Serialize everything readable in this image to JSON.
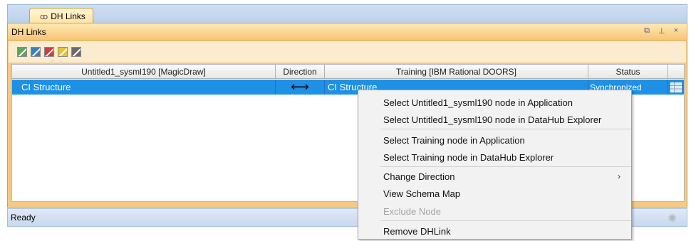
{
  "tab": {
    "label": "DH Links",
    "icon": "dh-links-icon"
  },
  "panel": {
    "title": "DH Links",
    "controls": [
      {
        "name": "restore-icon",
        "glyph": "⧉"
      },
      {
        "name": "pin-icon",
        "glyph": "⊥"
      },
      {
        "name": "close-icon",
        "glyph": "×"
      }
    ]
  },
  "toolbar": {
    "buttons": [
      {
        "name": "green-link-icon",
        "color": "#5ca65c"
      },
      {
        "name": "blue-link-icon",
        "color": "#3a7fc4"
      },
      {
        "name": "red-link-icon",
        "color": "#d43b3b"
      },
      {
        "name": "yellow-link-icon",
        "color": "#e6c43a"
      },
      {
        "name": "gray-link-icon",
        "color": "#6b6b6b"
      }
    ]
  },
  "table": {
    "columns": [
      "Untitled1_sysml190 [MagicDraw]",
      "Direction",
      "Training [IBM Rational DOORS]",
      "Status"
    ],
    "rows": [
      {
        "source": "CI Structure",
        "direction": "⟷",
        "target": "CI Structure",
        "status": "Synchronized"
      }
    ]
  },
  "statusbar": {
    "text": "Ready"
  },
  "context_menu": {
    "items": [
      {
        "label": "Select Untitled1_sysml190 node in Application",
        "enabled": true
      },
      {
        "label": "Select Untitled1_sysml190 node in DataHub Explorer",
        "enabled": true
      },
      {
        "label": "Select Training node in Application",
        "enabled": true
      },
      {
        "label": "Select Training node in DataHub Explorer",
        "enabled": true
      },
      {
        "label": "Change Direction",
        "enabled": true,
        "submenu_arrow": "›"
      },
      {
        "label": "View Schema Map",
        "enabled": true
      },
      {
        "label": "Exclude Node",
        "enabled": false
      },
      {
        "label": "Remove DHLink",
        "enabled": true
      }
    ]
  },
  "colors": {
    "selection": "#1e90e6",
    "panel_accent": "#f7c676"
  }
}
